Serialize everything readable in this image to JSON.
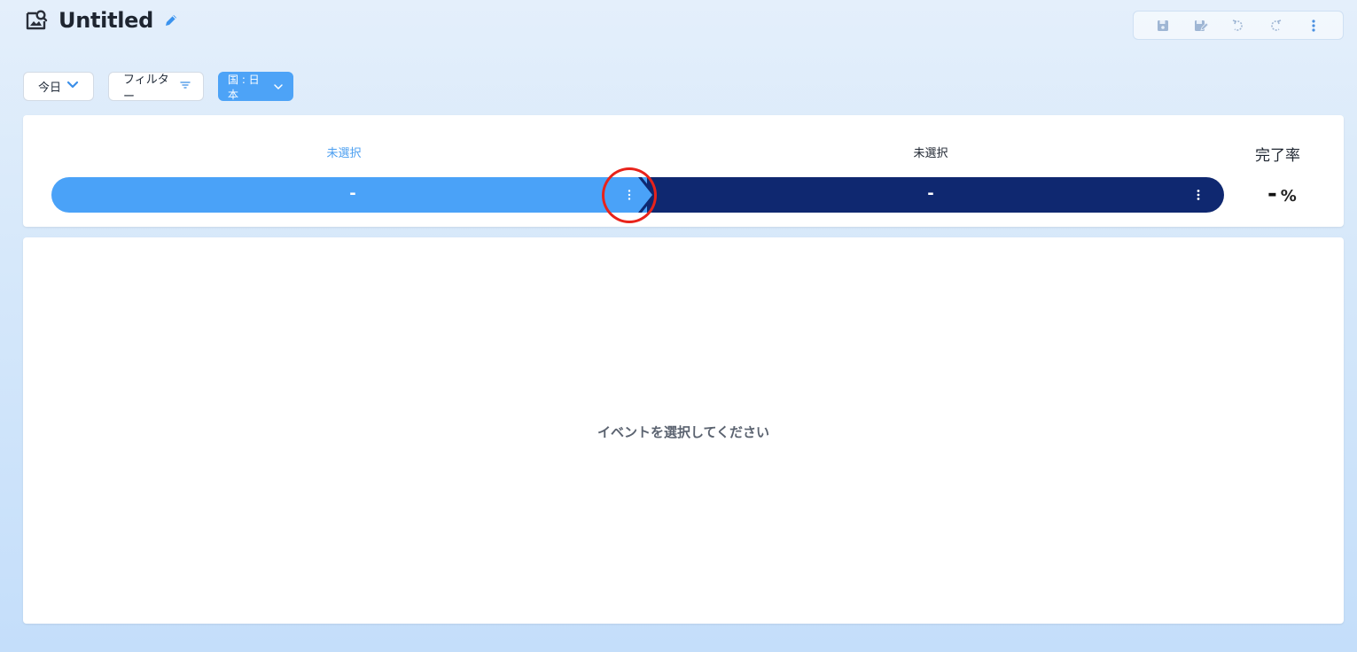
{
  "header": {
    "title": "Untitled",
    "title_icon": "image-search-icon",
    "edit_icon": "pencil-icon"
  },
  "toolbar": {
    "buttons": [
      "save-icon",
      "save-as-icon",
      "undo-icon",
      "redo-icon",
      "more-vertical-icon"
    ]
  },
  "filters": {
    "date_label": "今日",
    "filter_label": "フィルター",
    "country_label": "国 : 日本"
  },
  "funnel": {
    "steps": [
      {
        "label": "未選択",
        "value": "-"
      },
      {
        "label": "未選択",
        "value": "-"
      }
    ],
    "completion_label": "完了率",
    "completion_value": "-",
    "completion_unit": "%"
  },
  "main": {
    "empty_message": "イベントを選択してください"
  },
  "colors": {
    "accent": "#4aa2f8",
    "dark_bar": "#0f2870",
    "highlight": "#e8231b"
  }
}
